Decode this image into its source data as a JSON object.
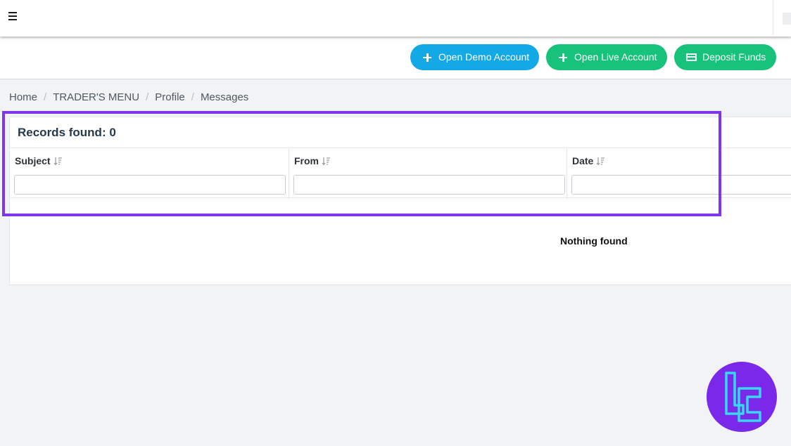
{
  "topbar": {
    "menu_icon": "hamburger-menu-icon"
  },
  "actions": {
    "open_demo": {
      "label": "Open Demo Account",
      "icon": "plus-icon",
      "color": "#12a9e6"
    },
    "open_live": {
      "label": "Open Live Account",
      "icon": "plus-icon",
      "color": "#17c27a"
    },
    "deposit": {
      "label": "Deposit Funds",
      "icon": "credit-card-icon",
      "color": "#17c27a"
    }
  },
  "breadcrumb": [
    "Home",
    "TRADER'S MENU",
    "Profile",
    "Messages"
  ],
  "breadcrumb_separator": "/",
  "messages": {
    "records_found": "Records found: 0",
    "columns": [
      {
        "label": "Subject",
        "filter_value": ""
      },
      {
        "label": "From",
        "filter_value": ""
      },
      {
        "label": "Date",
        "filter_value": ""
      }
    ],
    "empty_text": "Nothing found"
  },
  "highlight_color": "#7f35ea",
  "badge": {
    "logo": "tc-logo",
    "color": "#7a28ea",
    "accent": "#35d8f0"
  }
}
